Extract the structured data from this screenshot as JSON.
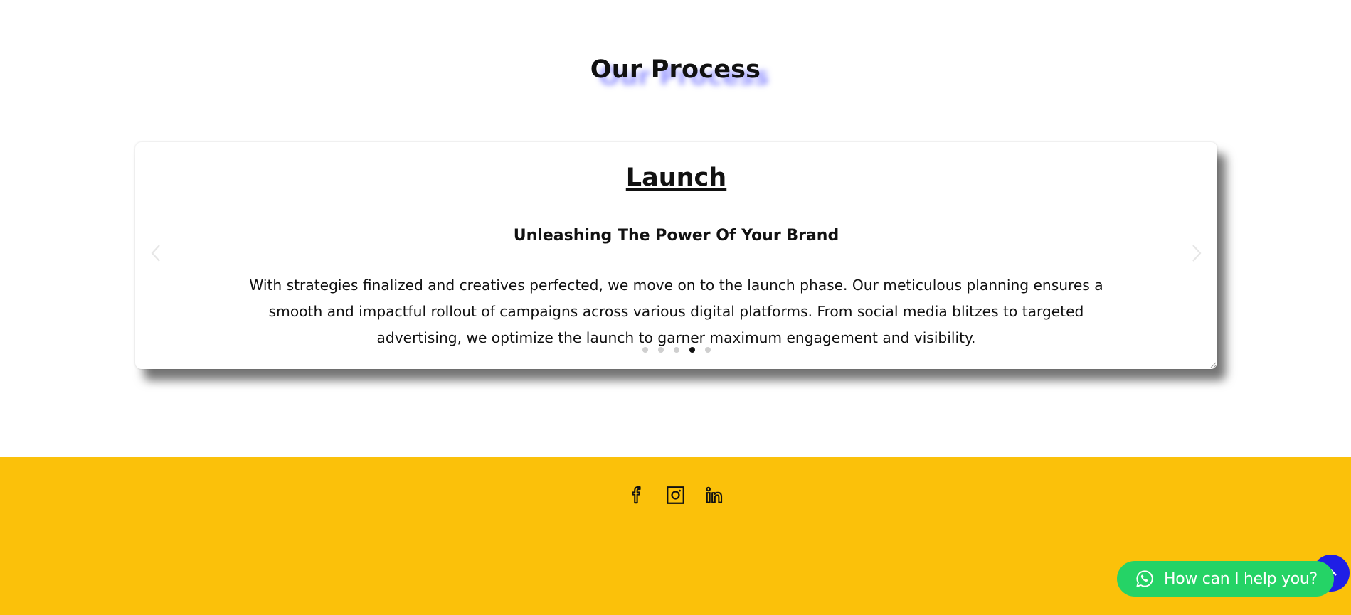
{
  "process": {
    "title": "Our Process"
  },
  "carousel": {
    "slide_title": "Launch",
    "slide_subtitle": "Unleashing The Power Of Your Brand",
    "slide_body": "With strategies finalized and creatives perfected, we move on to the launch phase. Our meticulous planning ensures a smooth and impactful rollout of campaigns across various digital platforms. From social media blitzes to targeted advertising, we optimize the launch to garner maximum engagement and visibility.",
    "prev_icon": "chevron-left-icon",
    "next_icon": "chevron-right-icon",
    "slide_count": 5,
    "active_slide": 4
  },
  "footer": {
    "background": "#fbc10a",
    "social_icons": [
      "facebook-icon",
      "instagram-icon",
      "linkedin-icon"
    ]
  },
  "chat": {
    "label": "How can I help you?",
    "icon": "whatsapp-icon",
    "color": "#25d366"
  },
  "scroll_top": {
    "icon": "arrow-up-icon",
    "color": "#1f1fe6"
  }
}
